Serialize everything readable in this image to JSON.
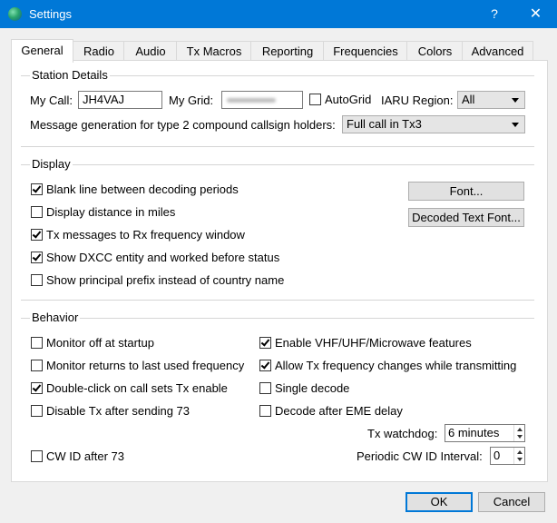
{
  "window": {
    "title": "Settings",
    "help_label": "?",
    "close_label": "✕"
  },
  "tabs": [
    "General",
    "Radio",
    "Audio",
    "Tx Macros",
    "Reporting",
    "Frequencies",
    "Colors",
    "Advanced"
  ],
  "active_tab": "General",
  "station": {
    "group_title": "Station Details",
    "my_call_label": "My Call:",
    "my_call_value": "JH4VAJ",
    "my_grid_label": "My Grid:",
    "autogrid_label": "AutoGrid",
    "autogrid_checked": false,
    "iaru_label": "IARU Region:",
    "iaru_value": "All",
    "msg_gen_label": "Message generation for type 2 compound callsign holders:",
    "msg_gen_value": "Full call in Tx3"
  },
  "display": {
    "group_title": "Display",
    "options": [
      {
        "label": "Blank line between decoding periods",
        "checked": true
      },
      {
        "label": "Display distance in miles",
        "checked": false
      },
      {
        "label": "Tx messages to Rx frequency window",
        "checked": true
      },
      {
        "label": "Show DXCC entity and worked before status",
        "checked": true
      },
      {
        "label": "Show principal prefix instead of country name",
        "checked": false
      }
    ],
    "font_button": "Font...",
    "decoded_font_button": "Decoded Text Font..."
  },
  "behavior": {
    "group_title": "Behavior",
    "left_options": [
      {
        "label": "Monitor off at startup",
        "checked": false
      },
      {
        "label": "Monitor returns to last used frequency",
        "checked": false
      },
      {
        "label": "Double-click on call sets Tx enable",
        "checked": true
      },
      {
        "label": "Disable Tx after sending 73",
        "checked": false
      }
    ],
    "right_options": [
      {
        "label": "Enable VHF/UHF/Microwave features",
        "checked": true
      },
      {
        "label": "Allow Tx frequency changes while transmitting",
        "checked": true
      },
      {
        "label": "Single decode",
        "checked": false
      },
      {
        "label": "Decode after EME delay",
        "checked": false
      }
    ],
    "tx_watchdog_label": "Tx watchdog:",
    "tx_watchdog_value": "6 minutes",
    "cw_id_label": "CW ID after 73",
    "cw_id_checked": false,
    "periodic_cw_label": "Periodic CW ID Interval:",
    "periodic_cw_value": "0"
  },
  "footer": {
    "ok_label": "OK",
    "cancel_label": "Cancel"
  }
}
